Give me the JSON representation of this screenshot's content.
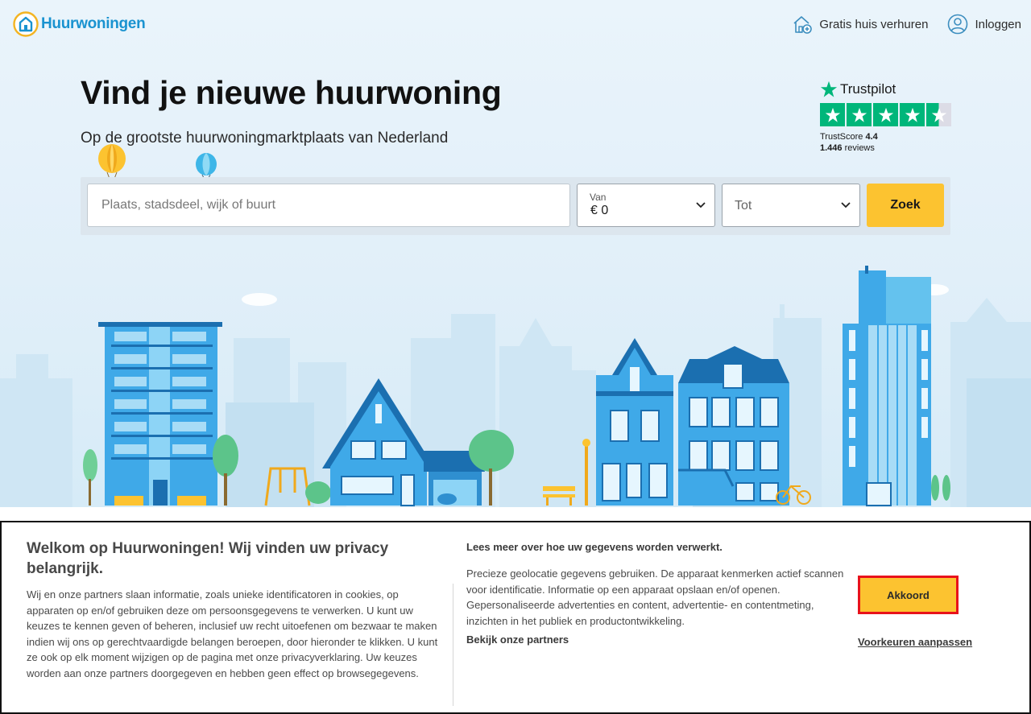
{
  "header": {
    "logo_text": "Huurwoningen",
    "nav": [
      {
        "label": "Gratis huis verhuren",
        "icon": "house-plus-icon"
      },
      {
        "label": "Inloggen",
        "icon": "user-circle-icon"
      }
    ]
  },
  "hero": {
    "title": "Vind je nieuwe huurwoning",
    "subtitle": "Op de grootste huurwoningmarktplaats van Nederland"
  },
  "trustpilot": {
    "brand": "Trustpilot",
    "score_label": "TrustScore",
    "score": "4.4",
    "review_count": "1.446",
    "reviews_label": "reviews",
    "stars_filled": 4.5,
    "stars_total": 5
  },
  "search": {
    "placeholder": "Plaats, stadsdeel, wijk of buurt",
    "van_label": "Van",
    "van_value": "€ 0",
    "tot_placeholder": "Tot",
    "button_label": "Zoek"
  },
  "consent": {
    "title": "Welkom op Huurwoningen! Wij vinden uw privacy belangrijk.",
    "body": "Wij en onze partners slaan informatie, zoals unieke identificatoren in cookies, op apparaten op en/of gebruiken deze om persoonsgegevens te verwerken. U kunt uw keuzes te kennen geven of beheren, inclusief uw recht uitoefenen om bezwaar te maken indien wij ons op gerechtvaardigde belangen beroepen, door hieronder te klikken. U kunt ze ook op elk moment wijzigen op de pagina met onze privacyverklaring. Uw keuzes worden aan onze partners doorgegeven en hebben geen effect op browsegegevens.",
    "right_title": "Lees meer over hoe uw gegevens worden verwerkt.",
    "right_body": "Precieze geolocatie gegevens gebruiken. De apparaat kenmerken actief scannen voor identificatie. Informatie op een apparaat opslaan en/of openen. Gepersonaliseerde advertenties en content, advertentie- en contentmeting, inzichten in het publiek en productontwikkeling.",
    "partners_link": "Bekijk onze partners",
    "accept_label": "Akkoord",
    "preferences_link": "Voorkeuren aanpassen"
  },
  "colors": {
    "brand_blue": "#1a93d0",
    "accent_yellow": "#fcc330",
    "trustpilot_green": "#00b67a",
    "highlight_red": "#e8121b"
  }
}
